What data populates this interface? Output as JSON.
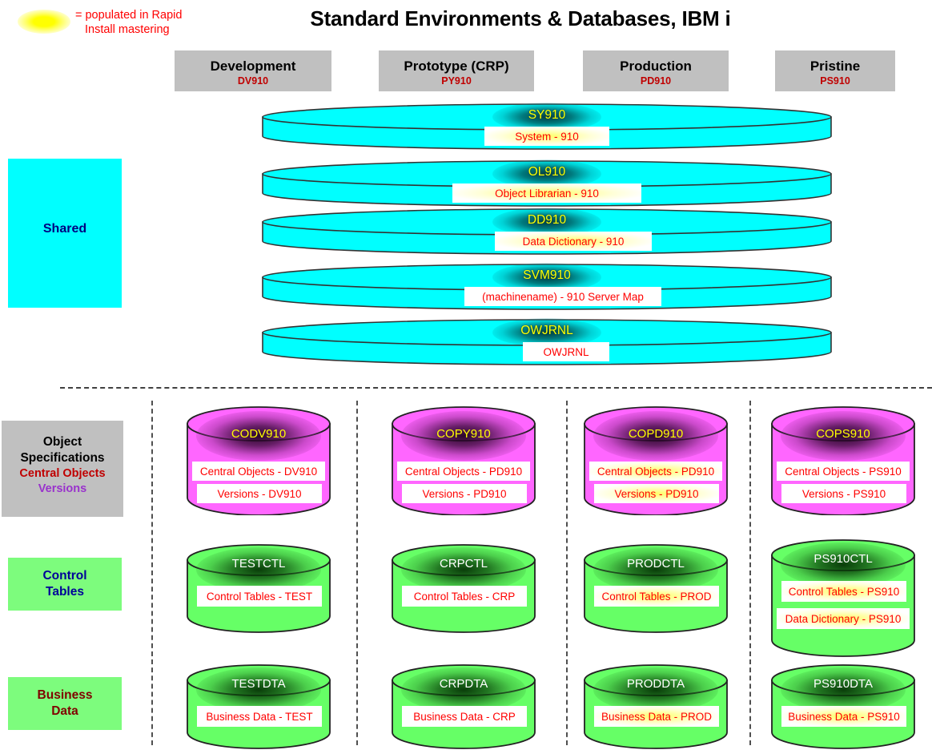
{
  "legend": {
    "icon": "yellow-glow-blob",
    "line1": "= populated in Rapid",
    "line2": "Install mastering",
    "color": "#ff0000"
  },
  "title": "Standard Environments & Databases,  IBM i",
  "columns": [
    {
      "name": "Development",
      "code": "DV910"
    },
    {
      "name": "Prototype (CRP)",
      "code": "PY910"
    },
    {
      "name": "Production",
      "code": "PD910"
    },
    {
      "name": "Pristine",
      "code": "PS910"
    }
  ],
  "row_labels": {
    "shared": "Shared",
    "object_specifications": {
      "line1": "Object",
      "line2": "Specifications",
      "line3": "Central Objects",
      "line4": "Versions"
    },
    "control_tables": {
      "line1": "Control",
      "line2": "Tables"
    },
    "business_data": {
      "line1": "Business",
      "line2": "Data"
    }
  },
  "shared_databases": [
    {
      "name": "SY910",
      "labels": [
        {
          "text": "System - 910",
          "glow": true
        }
      ]
    },
    {
      "name": "OL910",
      "labels": [
        {
          "text": "Object Librarian - 910",
          "glow": true
        }
      ]
    },
    {
      "name": "DD910",
      "labels": [
        {
          "text": "Data Dictionary - 910",
          "glow": true
        }
      ]
    },
    {
      "name": "SVM910",
      "labels": [
        {
          "text": "(machinename) - 910 Server Map",
          "glow": false
        }
      ]
    },
    {
      "name": "OWJRNL",
      "labels": [
        {
          "text": "OWJRNL",
          "glow": false
        }
      ]
    }
  ],
  "object_spec_databases": [
    {
      "column": "Development",
      "name": "CODV910",
      "labels": [
        {
          "text": "Central Objects - DV910",
          "glow": false
        },
        {
          "text": "Versions - DV910",
          "glow": false
        }
      ]
    },
    {
      "column": "Prototype (CRP)",
      "name": "COPY910",
      "labels": [
        {
          "text": "Central Objects - PD910",
          "glow": false
        },
        {
          "text": "Versions - PD910",
          "glow": false
        }
      ]
    },
    {
      "column": "Production",
      "name": "COPD910",
      "labels": [
        {
          "text": "Central Objects - PD910",
          "glow": true
        },
        {
          "text": "Versions - PD910",
          "glow": true
        }
      ]
    },
    {
      "column": "Pristine",
      "name": "COPS910",
      "labels": [
        {
          "text": "Central Objects - PS910",
          "glow": false
        },
        {
          "text": "Versions - PS910",
          "glow": false
        }
      ]
    }
  ],
  "control_table_databases": [
    {
      "column": "Development",
      "name": "TESTCTL",
      "labels": [
        {
          "text": "Control Tables - TEST",
          "glow": false
        }
      ]
    },
    {
      "column": "Prototype (CRP)",
      "name": "CRPCTL",
      "labels": [
        {
          "text": "Control Tables - CRP",
          "glow": false
        }
      ]
    },
    {
      "column": "Production",
      "name": "PRODCTL",
      "labels": [
        {
          "text": "Control Tables - PROD",
          "glow": true
        }
      ]
    },
    {
      "column": "Pristine",
      "name": "PS910CTL",
      "labels": [
        {
          "text": "Control Tables - PS910",
          "glow": true
        },
        {
          "text": "Data Dictionary - PS910",
          "glow": true
        }
      ]
    }
  ],
  "business_data_databases": [
    {
      "column": "Development",
      "name": "TESTDTA",
      "labels": [
        {
          "text": "Business Data - TEST",
          "glow": false
        }
      ]
    },
    {
      "column": "Prototype (CRP)",
      "name": "CRPDTA",
      "labels": [
        {
          "text": "Business Data - CRP",
          "glow": false
        }
      ]
    },
    {
      "column": "Production",
      "name": "PRODDTA",
      "labels": [
        {
          "text": "Business Data - PROD",
          "glow": true
        }
      ]
    },
    {
      "column": "Pristine",
      "name": "PS910DTA",
      "labels": [
        {
          "text": "Business Data - PS910",
          "glow": true
        }
      ]
    }
  ],
  "colors": {
    "shared_cylinder": "#00ffff",
    "object_spec_cylinder": "#ff66ff",
    "data_cylinder": "#66ff66",
    "header_box": "#c0c0c0",
    "label_text": "#ff0000",
    "cap_label_shared": "#ffff00",
    "highlight_glow": "#ffff00"
  }
}
